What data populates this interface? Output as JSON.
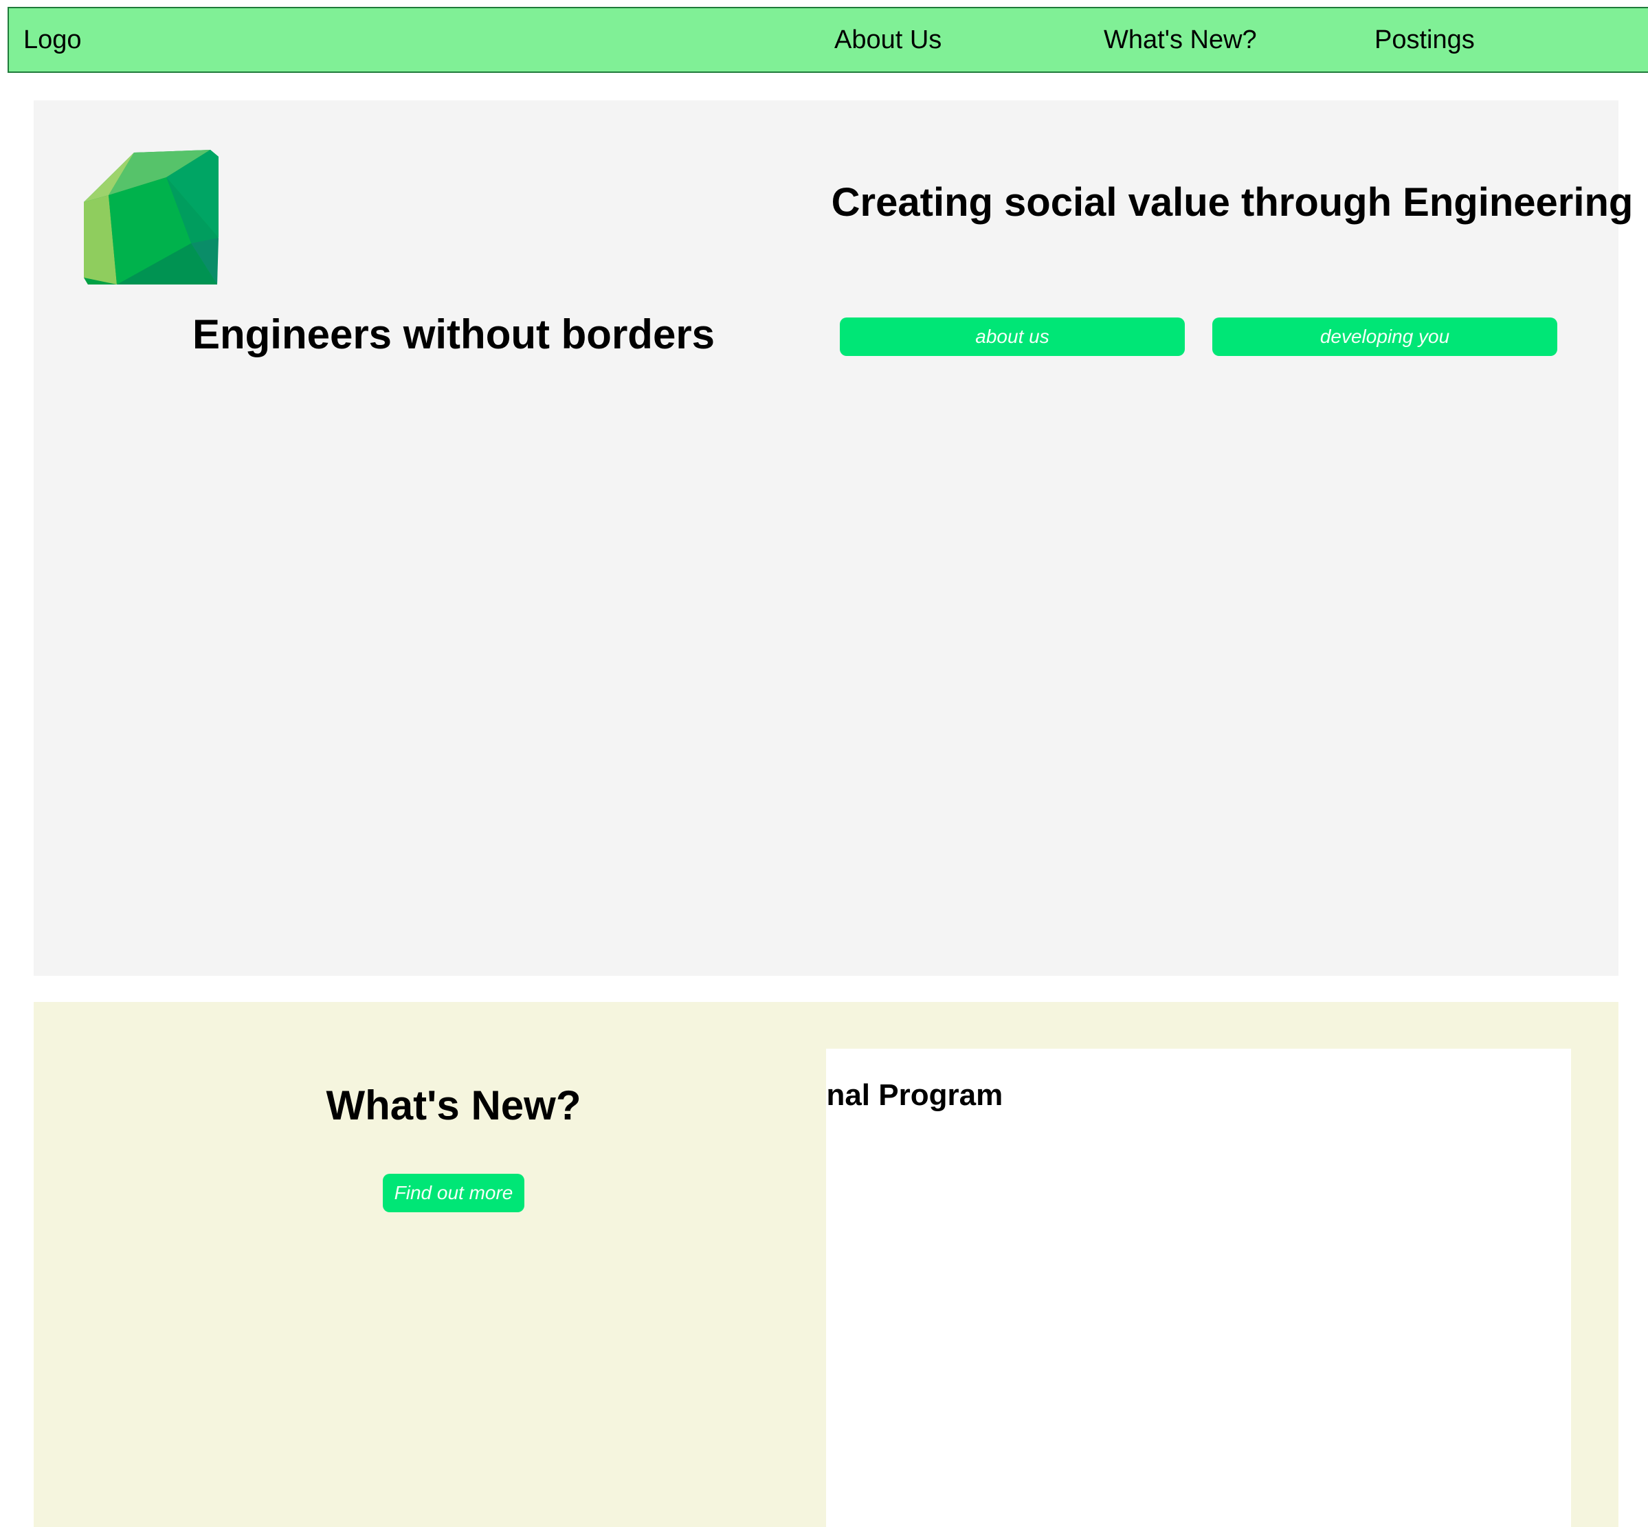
{
  "nav": {
    "logo_text": "Logo",
    "links": [
      "About Us",
      "What's New?",
      "Postings"
    ],
    "background_color": "#80f096"
  },
  "hero": {
    "logo_icon": "green-gem-icon",
    "org_name": "Engineers without borders",
    "tagline": "Creating social value through Engineering",
    "buttons": [
      "about us",
      "developing you"
    ],
    "background_color": "#f4f4f4",
    "button_color": "#00e676"
  },
  "news": {
    "heading": "What's New?",
    "button_label": "Find out more",
    "panel_title": "International Program",
    "background_color": "#f5f5de"
  }
}
